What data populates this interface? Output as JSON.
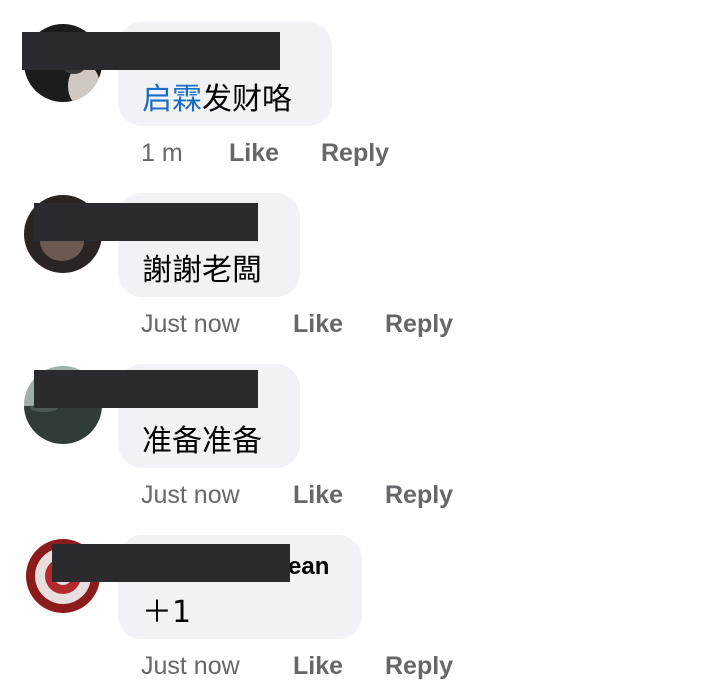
{
  "comments": [
    {
      "name_visible": "",
      "mention": "启霖",
      "text": "发财咯",
      "time": "1 m",
      "like": "Like",
      "reply": "Reply"
    },
    {
      "name_visible": "",
      "text": "謝謝老闆",
      "time": "Just now",
      "like": "Like",
      "reply": "Reply"
    },
    {
      "name_visible": "",
      "text": "准备准备",
      "time": "Just now",
      "like": "Like",
      "reply": "Reply"
    },
    {
      "name_visible": "ean",
      "text": "＋1",
      "time": "Just now",
      "like": "Like",
      "reply": "Reply"
    }
  ],
  "icons": {
    "avatar_1": "profile-photo-dark",
    "avatar_2": "profile-photo-face",
    "avatar_3": "profile-photo-landscape",
    "avatar_4": "profile-photo-red-seal"
  }
}
